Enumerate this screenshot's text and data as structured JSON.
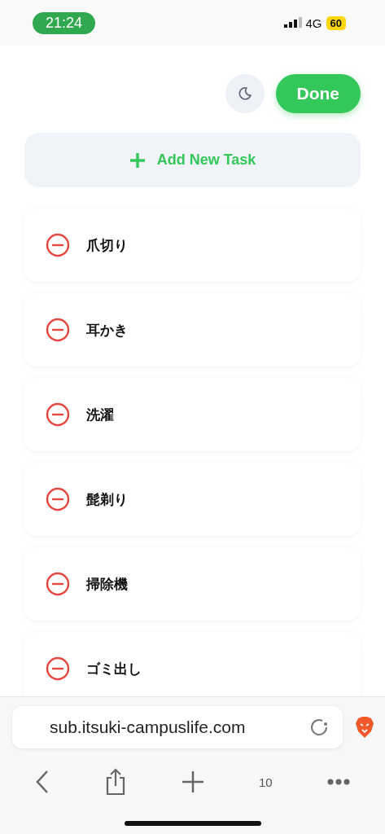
{
  "status_bar": {
    "time": "21:24",
    "network": "4G",
    "battery": "60"
  },
  "header": {
    "done_button": "Done"
  },
  "add_button": {
    "label": "Add New Task"
  },
  "tasks": [
    {
      "label": "爪切り"
    },
    {
      "label": "耳かき"
    },
    {
      "label": "洗濯"
    },
    {
      "label": "髭剃り"
    },
    {
      "label": "掃除機"
    },
    {
      "label": "ゴミ出し"
    }
  ],
  "browser": {
    "url": "sub.itsuki-campuslife.com",
    "tab_count": "10"
  }
}
